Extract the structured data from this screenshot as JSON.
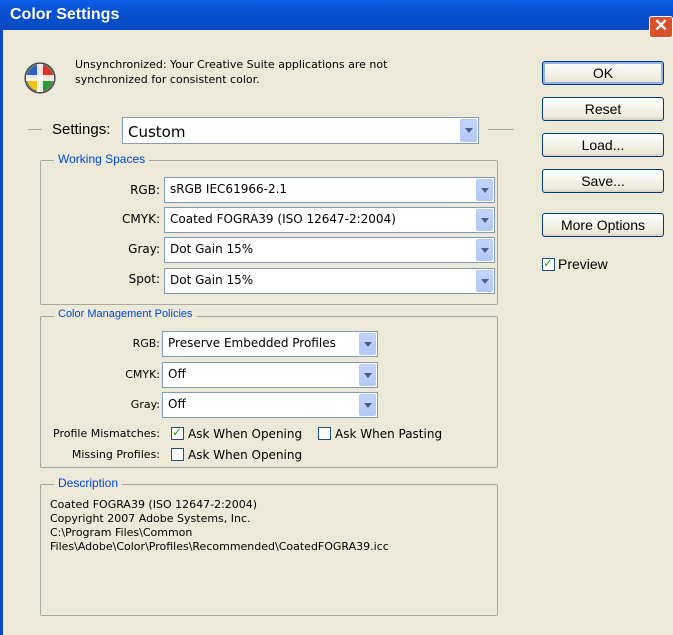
{
  "window": {
    "title": "Color Settings",
    "close_glyph": "✕"
  },
  "message": {
    "line1": "Unsynchronized: Your Creative Suite applications are not",
    "line2": "synchronized for consistent color."
  },
  "buttons": {
    "ok": "OK",
    "reset": "Reset",
    "load": "Load...",
    "save": "Save...",
    "more_options": "More Options"
  },
  "preview": {
    "label": "Preview",
    "checked": true
  },
  "settings": {
    "label": "Settings:",
    "value": "Custom"
  },
  "working_spaces": {
    "legend": "Working Spaces",
    "rgb": {
      "label": "RGB:",
      "value": "sRGB IEC61966-2.1"
    },
    "cmyk": {
      "label": "CMYK:",
      "value": "Coated FOGRA39 (ISO 12647-2:2004)"
    },
    "gray": {
      "label": "Gray:",
      "value": "Dot Gain 15%"
    },
    "spot": {
      "label": "Spot:",
      "value": "Dot Gain 15%"
    }
  },
  "policies": {
    "legend": "Color Management Policies",
    "rgb": {
      "label": "RGB:",
      "value": "Preserve Embedded Profiles"
    },
    "cmyk": {
      "label": "CMYK:",
      "value": "Off"
    },
    "gray": {
      "label": "Gray:",
      "value": "Off"
    },
    "mismatch_label": "Profile Mismatches:",
    "ask_opening": {
      "label": "Ask When Opening",
      "checked": true
    },
    "ask_pasting": {
      "label": "Ask When Pasting",
      "checked": false
    },
    "missing_label": "Missing Profiles:",
    "missing_ask_opening": {
      "label": "Ask When Opening",
      "checked": false
    }
  },
  "description": {
    "legend": "Description",
    "text": "Coated FOGRA39 (ISO 12647-2:2004)\nCopyright 2007 Adobe Systems, Inc.\nC:\\Program Files\\Common\nFiles\\Adobe\\Color\\Profiles\\Recommended\\CoatedFOGRA39.icc"
  },
  "colors": {
    "titlebar": "#0a50d0",
    "legend_text": "#0046d5",
    "dialog_bg": "#ece9d8"
  }
}
